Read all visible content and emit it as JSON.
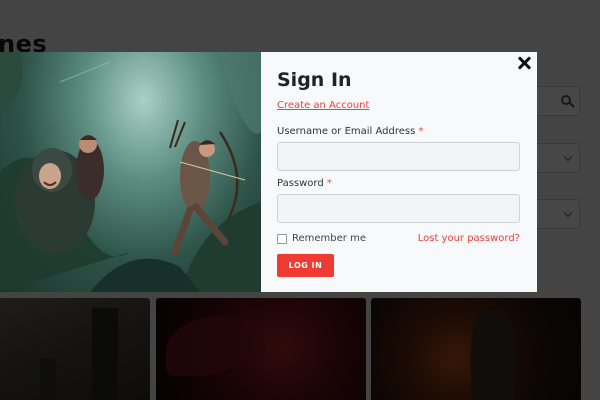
{
  "background": {
    "page_title": "nes"
  },
  "modal": {
    "title": "Sign In",
    "create_account": "Create an Account",
    "username_label": "Username or Email Address",
    "password_label": "Password",
    "required_mark": "*",
    "username_value": "",
    "password_value": "",
    "remember_label": "Remember me",
    "remember_checked": false,
    "lost_password": "Lost your password?",
    "login_button": "LOG IN"
  },
  "colors": {
    "accent": "#f03b34",
    "link": "#e9423a",
    "overlay": "rgba(0,0,0,0.72)"
  },
  "icons": {
    "close": "close-icon",
    "search": "search-icon",
    "dropdown": "chevron-down-icon"
  }
}
